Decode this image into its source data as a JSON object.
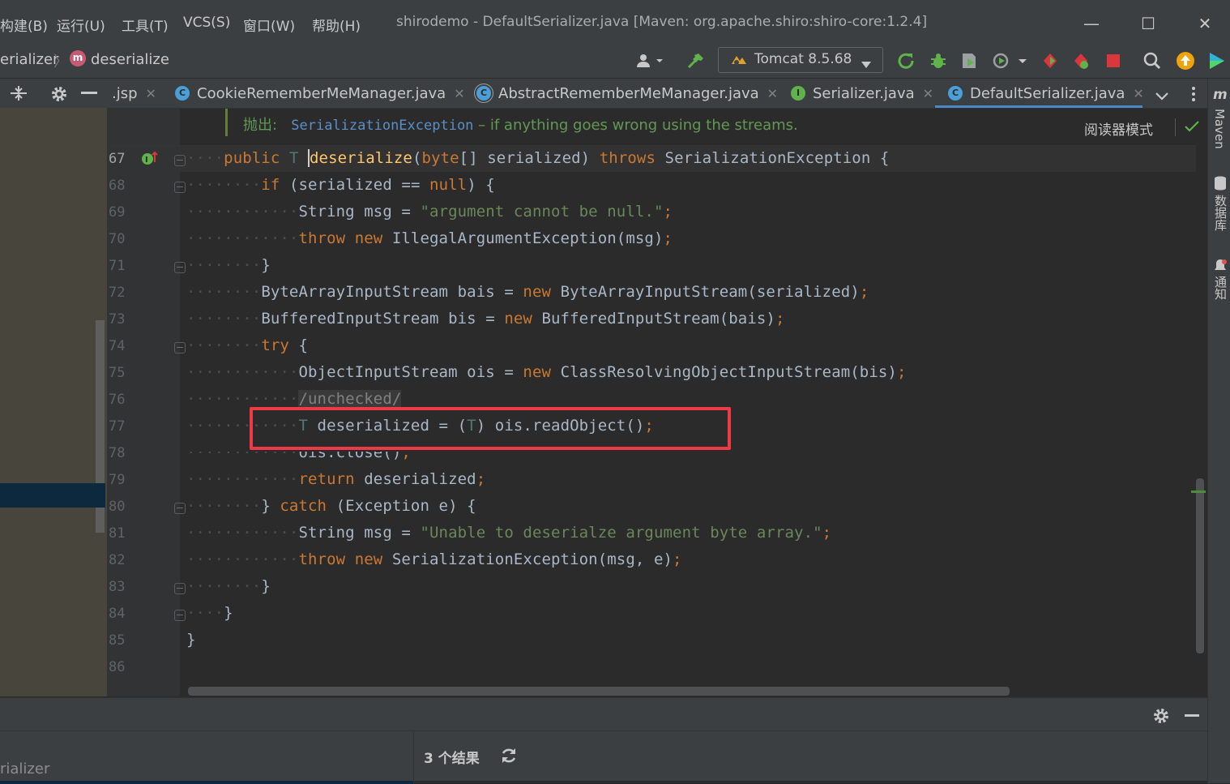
{
  "menu": [
    "构建(B)",
    "运行(U)",
    "工具(T)",
    "VCS(S)",
    "窗口(W)",
    "帮助(H)"
  ],
  "window_title": "shirodemo - DefaultSerializer.java [Maven: org.apache.shiro:shiro-core:1.2.4]",
  "window_buttons": {
    "minimize": "—",
    "maximize": "☐",
    "close": "✕"
  },
  "breadcrumb": {
    "parent": "erializer",
    "separator": "〉",
    "method_badge": "m",
    "method": "deserialize"
  },
  "run_config": {
    "label": "Tomcat 8.5.68"
  },
  "tabs": [
    {
      "label": ".jsp",
      "icon": ""
    },
    {
      "label": "CookieRememberMeManager.java",
      "icon": "C"
    },
    {
      "label": "AbstractRememberMeManager.java",
      "icon": "C"
    },
    {
      "label": "Serializer.java",
      "icon": "I"
    },
    {
      "label": "DefaultSerializer.java",
      "icon": "C"
    }
  ],
  "doc": {
    "label": "抛出:",
    "exception": "SerializationException",
    "text": " – if anything goes wrong using the streams."
  },
  "reader_mode": "阅读器模式",
  "line_numbers": [
    "67",
    "68",
    "69",
    "70",
    "71",
    "72",
    "73",
    "74",
    "75",
    "76",
    "77",
    "78",
    "79",
    "80",
    "81",
    "82",
    "83",
    "84",
    "85",
    "86"
  ],
  "code": {
    "l67": {
      "a": "public ",
      "b": "T ",
      "c": "deserialize",
      "d": "(",
      "e": "byte",
      "f": "[] serialized) ",
      "g": "throws ",
      "h": "SerializationException {"
    },
    "l68": {
      "a": "if ",
      "b": "(serialized == ",
      "c": "null",
      "d": ") {"
    },
    "l69": {
      "a": "String msg = ",
      "b": "\"argument cannot be null.\"",
      "c": ";"
    },
    "l70": {
      "a": "throw new ",
      "b": "IllegalArgumentException(msg)",
      "c": ";"
    },
    "l71": {
      "a": "}"
    },
    "l72": {
      "a": "ByteArrayInputStream bais = ",
      "b": "new ",
      "c": "ByteArrayInputStream(serialized)",
      "d": ";"
    },
    "l73": {
      "a": "BufferedInputStream bis = ",
      "b": "new ",
      "c": "BufferedInputStream(bais)",
      "d": ";"
    },
    "l74": {
      "a": "try ",
      "b": "{"
    },
    "l75": {
      "a": "ObjectInputStream ois = ",
      "b": "new ",
      "c": "ClassResolvingObjectInputStream(bis)",
      "d": ";"
    },
    "l76": {
      "a": "/unchecked/"
    },
    "l77": {
      "a": "T ",
      "b": "deserialized = (",
      "c": "T",
      "d": ") ois.readObject()",
      "e": ";"
    },
    "l78": {
      "a": "ois.close()",
      "b": ";"
    },
    "l79": {
      "a": "return ",
      "b": "deserialized",
      "c": ";"
    },
    "l80": {
      "a": "} ",
      "b": "catch ",
      "c": "(Exception e) {"
    },
    "l81": {
      "a": "String msg = ",
      "b": "\"Unable to deserialze argument byte array.\"",
      "c": ";"
    },
    "l82": {
      "a": "throw new ",
      "b": "SerializationException(msg, ",
      "c": "e)",
      "d": ";"
    },
    "l83": {
      "a": "}"
    },
    "l84": {
      "a": "}"
    },
    "l85": {
      "a": "}"
    }
  },
  "right_stripe": [
    "Maven",
    "数据库",
    "通知"
  ],
  "bottom": {
    "left_label": "rializer",
    "results": "3 个结果"
  },
  "colors": {
    "highlight_box": "#ee3a44",
    "keyword": "#cc7832",
    "string": "#6a8759",
    "method": "#ffc66d"
  }
}
